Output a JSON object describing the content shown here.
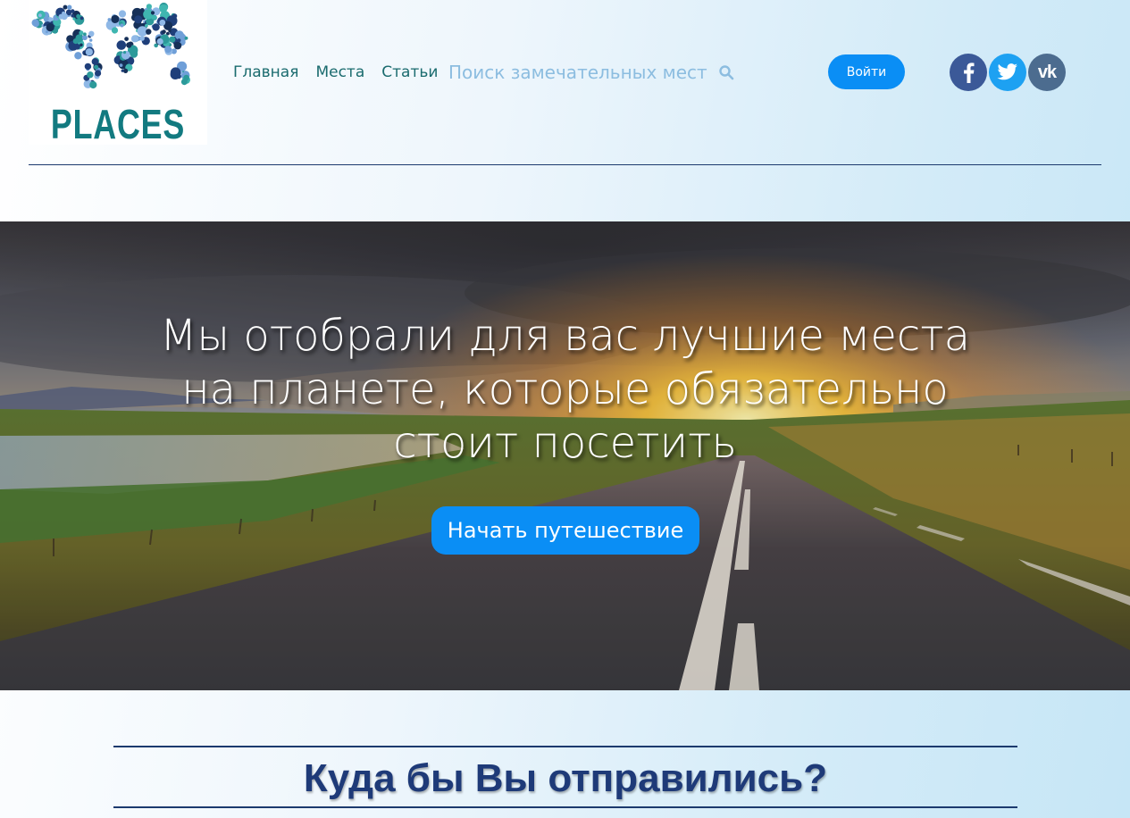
{
  "logo": {
    "text": "PLACES"
  },
  "nav": {
    "items": [
      "Главная",
      "Места",
      "Статьи"
    ]
  },
  "search": {
    "placeholder": "Поиск замечательных мест"
  },
  "auth": {
    "login_label": "Войти"
  },
  "social": {
    "facebook_icon": "facebook-icon",
    "twitter_icon": "twitter-icon",
    "vk_icon": "vk-icon",
    "vk_label": "vk"
  },
  "hero": {
    "title_lines": [
      "Мы отобрали для вас лучшие места",
      "на планете, которые обязательно",
      "стоит посетить"
    ],
    "cta_label": "Начать путешествие"
  },
  "section": {
    "title": "Куда бы Вы отправились?"
  },
  "colors": {
    "accent": "#0a8ef5",
    "nav_text": "#1a6b6e",
    "logo_text": "#127a80",
    "heading": "#1e3a78",
    "rule": "#1c3a6e"
  }
}
